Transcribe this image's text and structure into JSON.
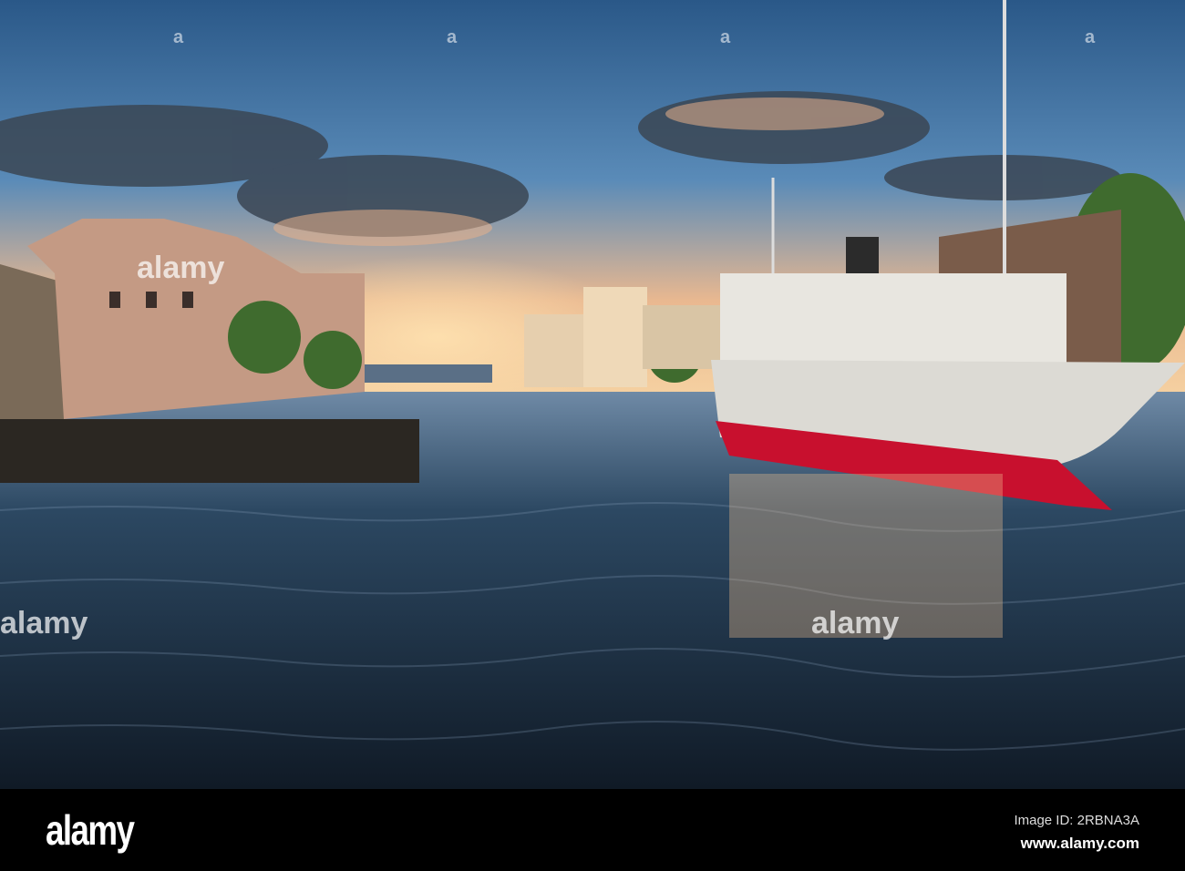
{
  "photo": {
    "subject": "harbour-scene",
    "colors": {
      "sky_top": "#2f5f8e",
      "sky_glow": "#f2b98a",
      "water": "#1b2a3a",
      "hull_red": "#c8102e",
      "hull_white": "#e8e6e0"
    }
  },
  "watermark": {
    "brand": "alamy",
    "repeat_mark": "a"
  },
  "footer": {
    "logo": "alamy",
    "image_id": "Image ID: 2RBNA3A",
    "url": "www.alamy.com"
  }
}
